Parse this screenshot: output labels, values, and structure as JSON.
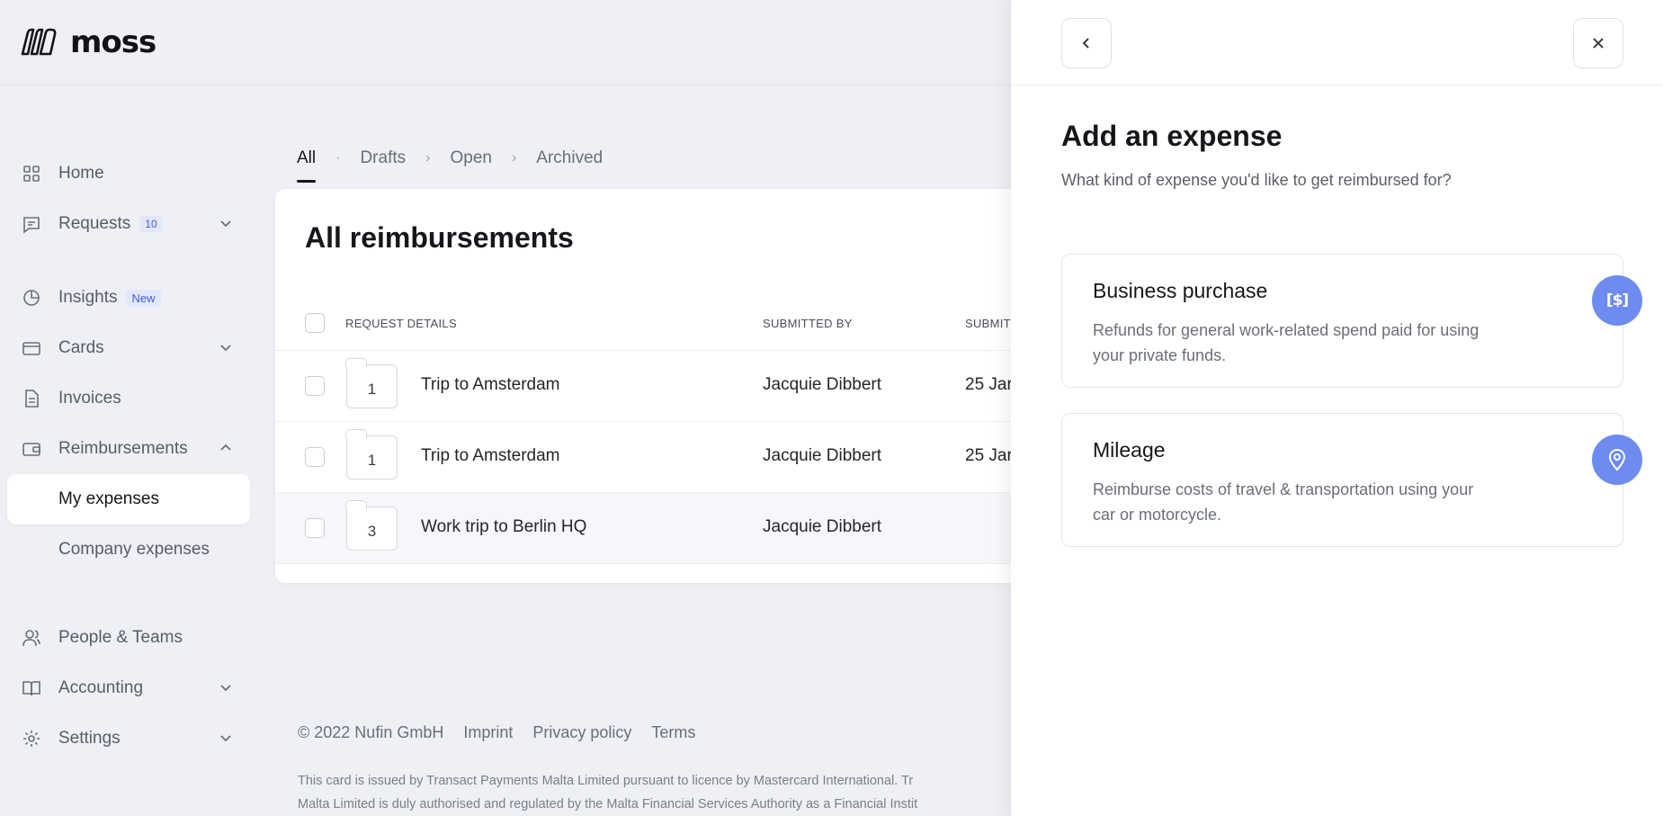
{
  "brand": {
    "name": "moss"
  },
  "sidebar": {
    "home": "Home",
    "requests": {
      "label": "Requests",
      "count": "10"
    },
    "insights": {
      "label": "Insights",
      "badge": "New"
    },
    "cards": "Cards",
    "invoices": "Invoices",
    "reimbursements": "Reimbursements",
    "my_expenses": "My expenses",
    "company_expenses": "Company expenses",
    "people_teams": "People & Teams",
    "accounting": "Accounting",
    "settings": "Settings"
  },
  "tabs": {
    "all": "All",
    "drafts": "Drafts",
    "open": "Open",
    "archived": "Archived",
    "dot": "·",
    "arrow": "›"
  },
  "table": {
    "title": "All reimbursements",
    "columns": {
      "details": "REQUEST DETAILS",
      "submitted_by": "SUBMITTED BY",
      "submitted_on": "SUBMIT"
    },
    "rows": [
      {
        "count": "1",
        "name": "Trip to Amsterdam",
        "by": "Jacquie Dibbert",
        "date": "25 Jar"
      },
      {
        "count": "1",
        "name": "Trip to Amsterdam",
        "by": "Jacquie Dibbert",
        "date": "25 Jar"
      },
      {
        "count": "3",
        "name": "Work trip to Berlin HQ",
        "by": "Jacquie Dibbert",
        "date": ""
      }
    ]
  },
  "footer": {
    "copyright": "© 2022 Nufin GmbH",
    "imprint": "Imprint",
    "privacy": "Privacy policy",
    "terms": "Terms",
    "legal_line1": "This card is issued by Transact Payments Malta Limited pursuant to licence by Mastercard International. Tr",
    "legal_line2": "Malta Limited is duly authorised and regulated by the Malta Financial Services Authority as a Financial Instit"
  },
  "panel": {
    "title": "Add an expense",
    "subtitle": "What kind of expense you'd like to get reimbursed for?",
    "options": [
      {
        "title": "Business purchase",
        "desc": "Refunds for general work-related spend paid for using your private funds.",
        "icon": "dollar-card-icon",
        "icon_text": "[$]"
      },
      {
        "title": "Mileage",
        "desc": "Reimburse costs of travel & transportation using your car or motorcycle.",
        "icon": "location-pin-icon"
      }
    ]
  },
  "colors": {
    "accent": "#6d8bf0",
    "badge_text": "#3e5cd6",
    "background": "#eef0f5"
  }
}
